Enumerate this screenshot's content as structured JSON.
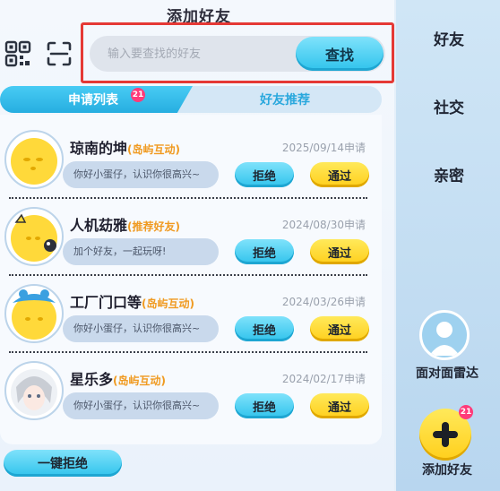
{
  "header": {
    "title": "添加好友"
  },
  "toolbar": {
    "qr_icon": "qr-code-icon",
    "scan_icon": "scan-icon"
  },
  "search": {
    "placeholder": "输入要查找的好友",
    "button_label": "查找"
  },
  "tabs": [
    {
      "label": "申请列表",
      "badge": "21",
      "active": true
    },
    {
      "label": "好友推荐",
      "active": false
    }
  ],
  "requests": [
    {
      "name": "琼南的坤",
      "tag": "(岛屿互动)",
      "date": "2025/09/14申请",
      "message": "你好小蛋仔，认识你很高兴~",
      "reject_label": "拒绝",
      "accept_label": "通过"
    },
    {
      "name": "人机苭雅",
      "tag": "(推荐好友)",
      "date": "2024/08/30申请",
      "message": "加个好友，一起玩呀!",
      "reject_label": "拒绝",
      "accept_label": "通过"
    },
    {
      "name": "工厂门口等",
      "tag": "(岛屿互动)",
      "date": "2024/03/26申请",
      "message": "你好小蛋仔，认识你很高兴~",
      "reject_label": "拒绝",
      "accept_label": "通过"
    },
    {
      "name": "星乐多",
      "tag": "(岛屿互动)",
      "date": "2024/02/17申请",
      "message": "你好小蛋仔，认识你很高兴~",
      "reject_label": "拒绝",
      "accept_label": "通过"
    }
  ],
  "footer": {
    "reject_all_label": "一键拒绝"
  },
  "sidebar": {
    "items": [
      {
        "label": "好友"
      },
      {
        "label": "社交"
      },
      {
        "label": "亲密"
      }
    ],
    "radar_label": "面对面雷达",
    "add_label": "添加好友",
    "add_badge": "21"
  },
  "colors": {
    "highlight": "#e53935",
    "accent_blue": "#30c3ec",
    "accent_yellow": "#ffcf1c",
    "tag_orange": "#f09a20",
    "badge_pink": "#ff3b79"
  }
}
